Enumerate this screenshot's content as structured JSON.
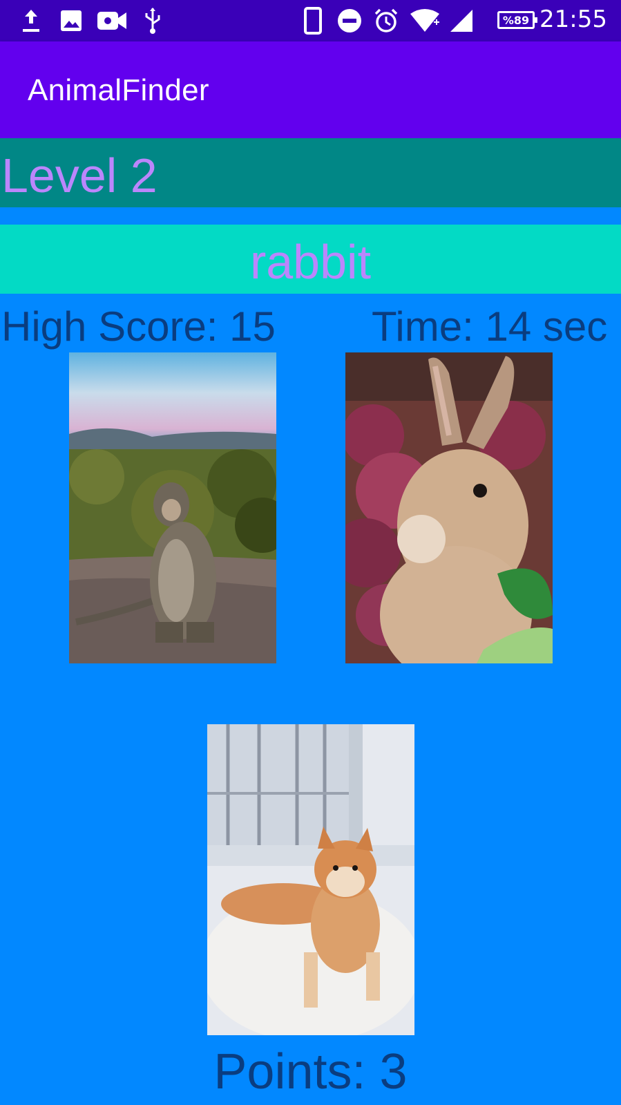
{
  "status_bar": {
    "icons": [
      "upload-icon",
      "image-icon",
      "video-camera-icon",
      "usb-icon",
      "phone-icon",
      "do-not-disturb-icon",
      "alarm-icon",
      "wifi-icon",
      "signal-icon",
      "battery-icon"
    ],
    "battery": "%89",
    "time": "21:55"
  },
  "app_bar": {
    "title": "AnimalFinder"
  },
  "game": {
    "level": "Level 2",
    "target": "rabbit",
    "high_score": "High Score: 15",
    "time": "Time: 14 sec",
    "points": "Points: 3",
    "choices": [
      "monkey",
      "rabbit",
      "dog"
    ]
  },
  "colors": {
    "status_bar": "#3a00b8",
    "app_bar": "#6200EE",
    "level_bar": "#018786",
    "target_bar": "#03DAC5",
    "accent_text": "#BB86FC",
    "background": "#0288FF",
    "stat_text": "#0a3d80"
  }
}
